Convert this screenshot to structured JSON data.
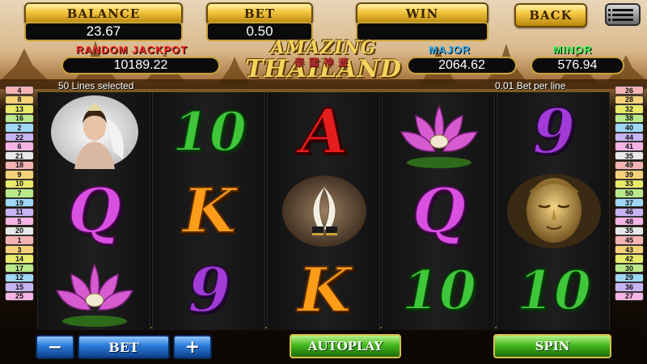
{
  "header": {
    "balance_label": "BALANCE",
    "balance_value": "23.67",
    "bet_label": "BET",
    "bet_value": "0.50",
    "win_label": "WIN",
    "win_value": "",
    "back_label": "BACK",
    "menu_icon": "hamburger-menu-icon"
  },
  "jackpots": {
    "random_label": "RANDOM  JACKPOT",
    "random_value": "10189.22",
    "major_label": "MAJOR",
    "major_value": "2064.62",
    "minor_label": "MINOR",
    "minor_value": "576.94"
  },
  "logo": {
    "line1": "AMAZING",
    "chinese": "泰國神遊",
    "line2": "THAILAND"
  },
  "info": {
    "lines_selected": "50 Lines selected",
    "bet_per_line": "0.01 Bet per line"
  },
  "left_lines": [
    "4",
    "8",
    "13",
    "16",
    "2",
    "22",
    "6",
    "21",
    "18",
    "9",
    "10",
    "7",
    "19",
    "11",
    "5",
    "20",
    "1",
    "3",
    "14",
    "17",
    "12",
    "15",
    "25"
  ],
  "right_lines": [
    "26",
    "28",
    "32",
    "38",
    "40",
    "44",
    "41",
    "35",
    "49",
    "39",
    "33",
    "50",
    "37",
    "46",
    "48",
    "35",
    "45",
    "43",
    "42",
    "30",
    "29",
    "36",
    "27"
  ],
  "reels": [
    [
      "lady-woman-symbol",
      "Q",
      "lotus-flower-symbol"
    ],
    [
      "10",
      "K",
      "9"
    ],
    [
      "A",
      "elephant-tusks-symbol",
      "K"
    ],
    [
      "lotus-flower-symbol",
      "Q",
      "10"
    ],
    [
      "9",
      "buddha-face-symbol",
      "10"
    ]
  ],
  "controls": {
    "minus_label": "−",
    "bet_label": "BET",
    "plus_label": "+",
    "autoplay_label": "AUTOPLAY",
    "spin_label": "SPIN"
  },
  "colors": {
    "gold": "#f5c842",
    "random_jackpot": "#ff2a2a",
    "major": "#39b6ff",
    "minor": "#3cff5a"
  }
}
